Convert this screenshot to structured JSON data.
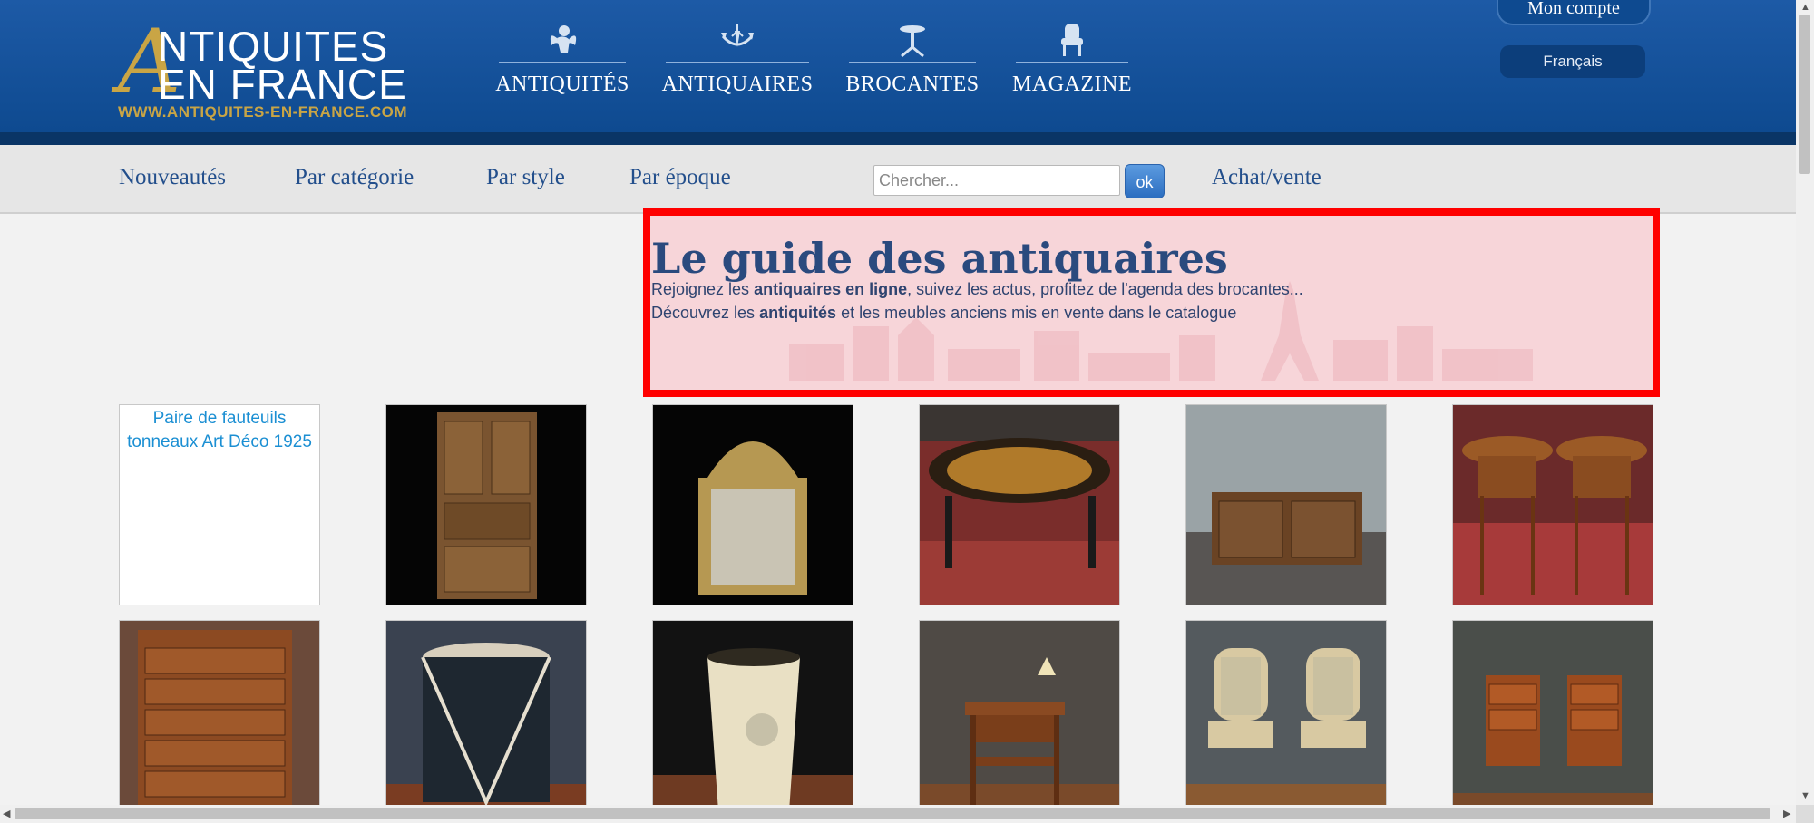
{
  "header": {
    "logo": {
      "line1": "NTIQUITES",
      "line2": "EN FRANCE",
      "big_letter": "A",
      "url": "WWW.ANTIQUITES-EN-FRANCE.COM"
    },
    "main_nav": [
      {
        "label": "ANTIQUITÉS",
        "icon": "cherub-icon"
      },
      {
        "label": "ANTIQUAIRES",
        "icon": "chandelier-icon"
      },
      {
        "label": "BROCANTES",
        "icon": "gueridon-table-icon"
      },
      {
        "label": "MAGAZINE",
        "icon": "armchair-icon"
      }
    ],
    "account": "Mon compte",
    "language": "Français"
  },
  "subnav": {
    "links": [
      "Nouveautés",
      "Par catégorie",
      "Par style",
      "Par époque"
    ],
    "search_placeholder": "Chercher...",
    "search_button": "ok",
    "achat_vente": "Achat/vente"
  },
  "guide": {
    "title": "Le guide des antiquaires",
    "line1_prefix": "Rejoignez les ",
    "line1_bold": "antiquaires en ligne",
    "line1_suffix": ", suivez les actus, profitez de l'agenda des brocantes...",
    "line2_prefix": "Découvrez les ",
    "line2_bold": "antiquités",
    "line2_suffix": " et les meubles anciens mis en vente dans le catalogue",
    "highlight_color": "#ff0000"
  },
  "products": {
    "broken_image_alt": "Paire de fauteuils tonneaux Art Déco 1925",
    "items": [
      "broken-image",
      "bookcase-photo",
      "gilt-mirror-photo",
      "marquetry-table-photo",
      "sideboard-photo",
      "side-tables-photo",
      "chest-of-drawers-photo",
      "drum-cabinet-photo",
      "wastebasket-photo",
      "writing-desk-photo",
      "armchairs-photo",
      "bedside-tables-photo"
    ]
  },
  "colors": {
    "header_blue": "#1d5aa6",
    "gold": "#c9a545",
    "link_blue": "#234f8c"
  }
}
